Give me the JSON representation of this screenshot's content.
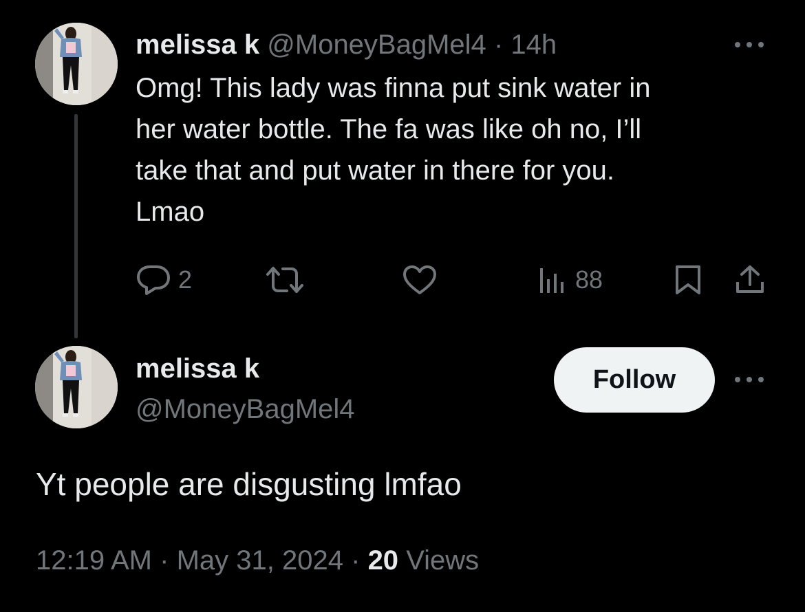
{
  "thread_tweet": {
    "display_name": "melissa k",
    "handle": "@MoneyBagMel4",
    "separator": "·",
    "time_ago": "14h",
    "text": "Omg! This lady was finna put sink water in\nher water bottle. The fa was like oh no, I’ll\ntake that and put water in there for you.\nLmao",
    "actions": {
      "reply_icon": "reply-icon",
      "reply_count": "2",
      "repost_icon": "repost-icon",
      "like_icon": "heart-icon",
      "views_icon": "views-bar-chart-icon",
      "views_count": "88",
      "bookmark_icon": "bookmark-icon",
      "share_icon": "share-icon"
    }
  },
  "main_tweet": {
    "display_name": "melissa k",
    "handle": "@MoneyBagMel4",
    "follow_label": "Follow",
    "text": "Yt people are disgusting lmfao",
    "time": "12:19 AM",
    "separator": "·",
    "date": "May 31, 2024",
    "views_count": "20",
    "views_label": "Views"
  },
  "colors": {
    "background": "#000000",
    "primary_text": "#e7e9ea",
    "secondary_text": "#71767b",
    "follow_button_bg": "#eff3f4",
    "follow_button_text": "#0f1419"
  }
}
